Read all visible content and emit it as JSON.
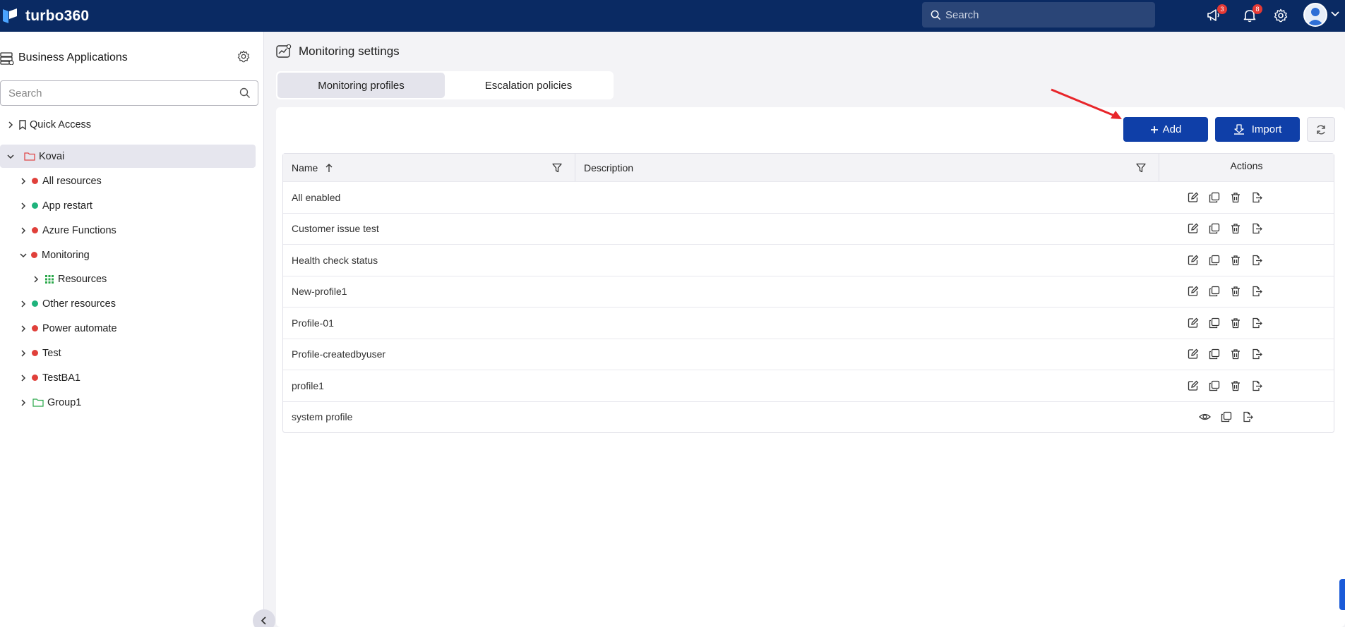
{
  "app": {
    "brand": "turbo360"
  },
  "topbar": {
    "search_placeholder": "Search",
    "announcements_count": "3",
    "notifications_count": "8"
  },
  "sidebar": {
    "title": "Business Applications",
    "search_placeholder": "Search",
    "quick_access": "Quick Access",
    "root": "Kovai",
    "items": [
      {
        "label": "All resources",
        "status": "red"
      },
      {
        "label": "App restart",
        "status": "green"
      },
      {
        "label": "Azure Functions",
        "status": "red"
      },
      {
        "label": "Monitoring",
        "status": "red"
      },
      {
        "label": "Resources",
        "status": "grid"
      },
      {
        "label": "Other resources",
        "status": "green"
      },
      {
        "label": "Power automate",
        "status": "red"
      },
      {
        "label": "Test",
        "status": "red"
      },
      {
        "label": "TestBA1",
        "status": "red"
      },
      {
        "label": "Group1",
        "status": "folder"
      }
    ]
  },
  "main": {
    "title": "Monitoring settings",
    "tabs": [
      "Monitoring profiles",
      "Escalation policies"
    ],
    "add_label": "Add",
    "import_label": "Import",
    "table": {
      "headers": {
        "name": "Name",
        "description": "Description",
        "actions": "Actions"
      },
      "rows": [
        {
          "name": "All enabled",
          "description": ""
        },
        {
          "name": "Customer issue test",
          "description": ""
        },
        {
          "name": "Health check status",
          "description": ""
        },
        {
          "name": "New-profile1",
          "description": ""
        },
        {
          "name": "Profile-01",
          "description": ""
        },
        {
          "name": "Profile-createdbyuser",
          "description": ""
        },
        {
          "name": "profile1",
          "description": ""
        },
        {
          "name": "system profile",
          "description": ""
        }
      ]
    }
  },
  "colors": {
    "topbar": "#0a2a63",
    "primary": "#0f3fa8",
    "status_red": "#e0403a",
    "status_green": "#1fb37c",
    "arrow": "#e8252a"
  }
}
